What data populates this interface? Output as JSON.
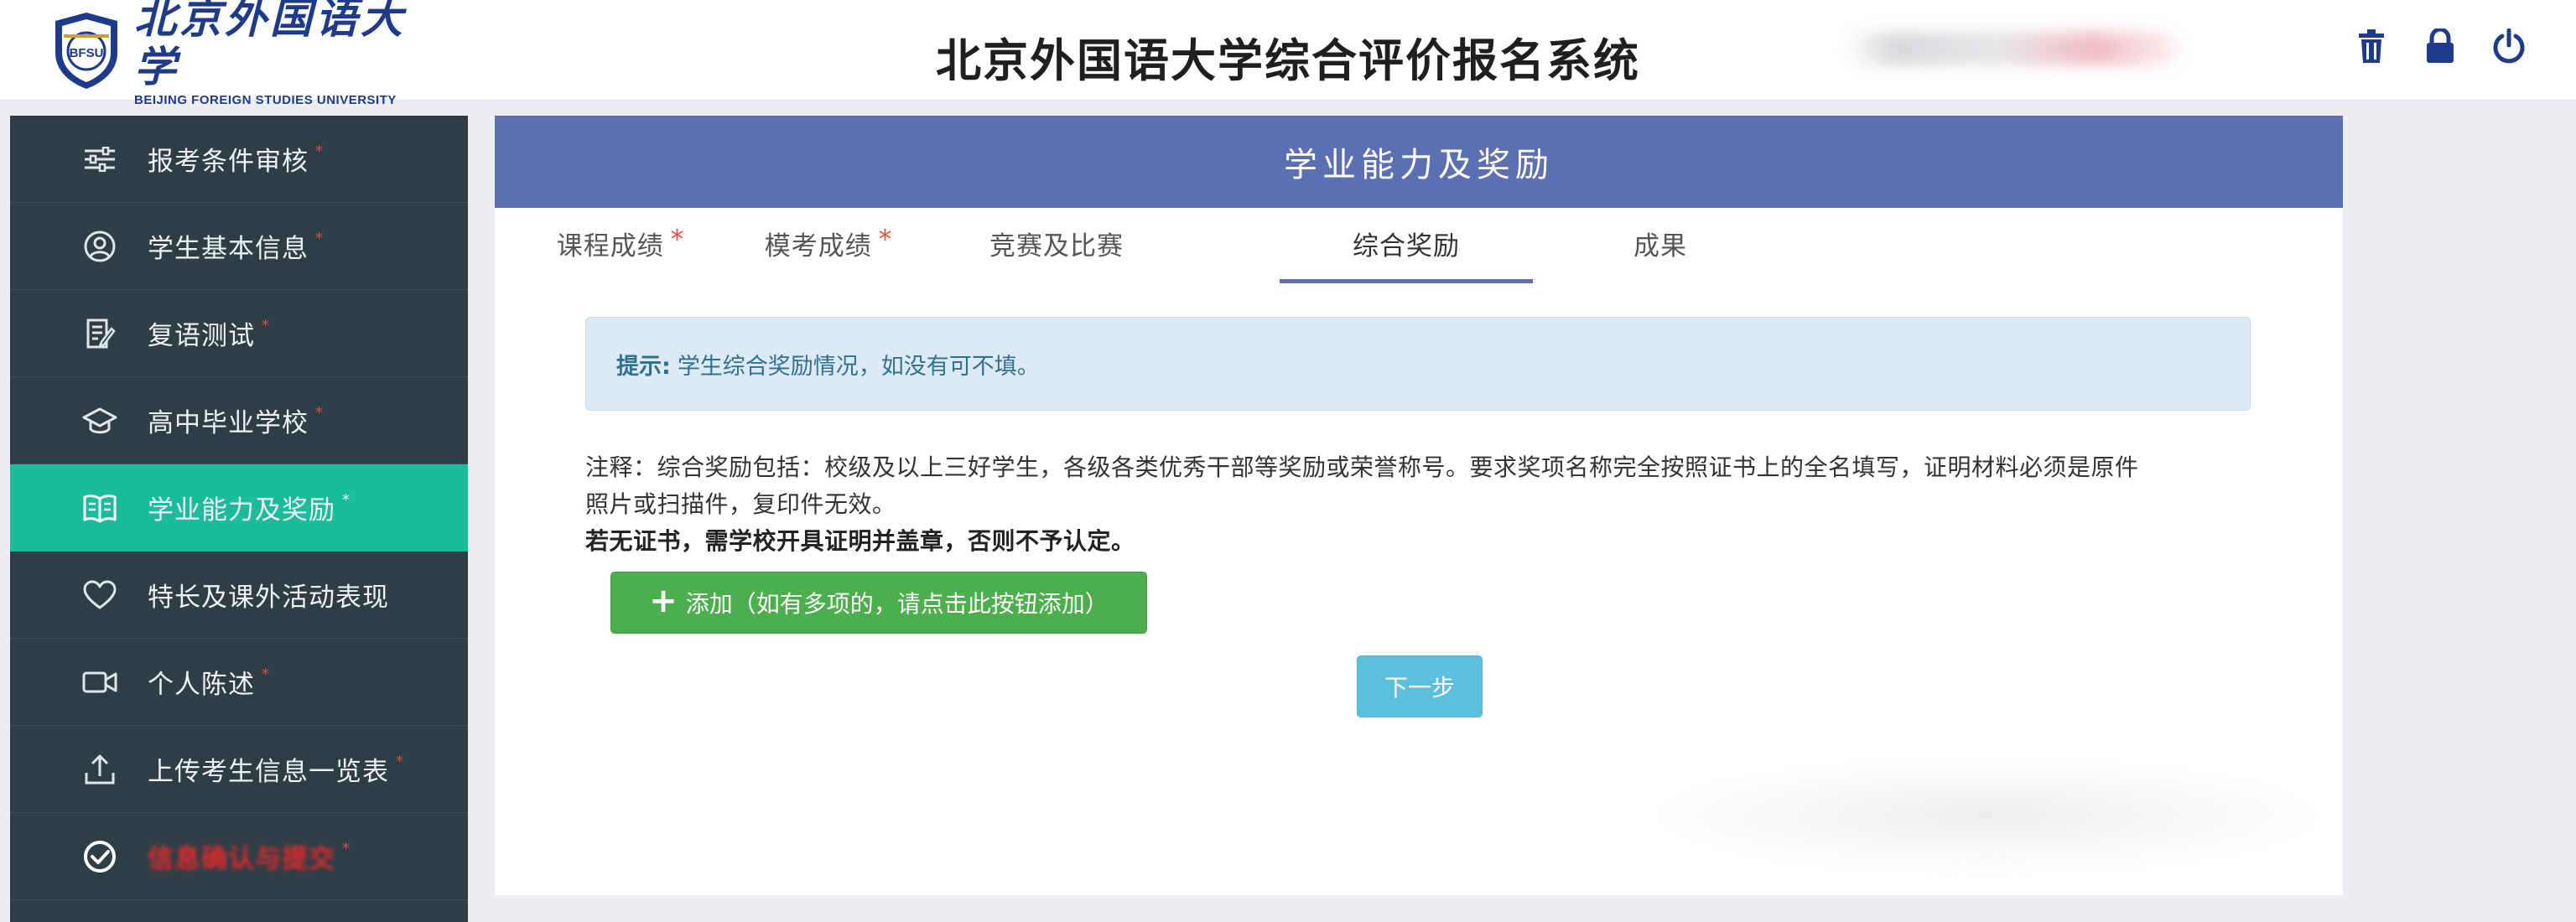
{
  "header": {
    "logo_cn": "北京外国语大学",
    "logo_en": "BEIJING FOREIGN STUDIES UNIVERSITY",
    "logo_seal_text": "BFSU",
    "title": "北京外国语大学综合评价报名系统",
    "icons": [
      "trash-icon",
      "lock-icon",
      "power-icon"
    ]
  },
  "sidebar": {
    "items": [
      {
        "label": "报考条件审核",
        "icon": "sliders-icon",
        "required": "*"
      },
      {
        "label": "学生基本信息",
        "icon": "user-circle-icon",
        "required": "*"
      },
      {
        "label": "复语测试",
        "icon": "edit-document-icon",
        "required": "*"
      },
      {
        "label": "高中毕业学校",
        "icon": "graduation-cap-icon",
        "required": "*"
      },
      {
        "label": "学业能力及奖励",
        "icon": "book-icon",
        "required": "*",
        "active": true
      },
      {
        "label": "特长及课外活动表现",
        "icon": "heart-icon",
        "required": ""
      },
      {
        "label": "个人陈述",
        "icon": "video-icon",
        "required": "*"
      },
      {
        "label": "上传考生信息一览表",
        "icon": "upload-icon",
        "required": "*"
      },
      {
        "label": "信息确认与提交",
        "icon": "check-circle-icon",
        "required": "*",
        "redacted": true
      }
    ]
  },
  "main": {
    "section_title": "学业能力及奖励",
    "tabs": [
      {
        "label": "课程成绩",
        "required": "*"
      },
      {
        "label": "模考成绩",
        "required": "*"
      },
      {
        "label": "竞赛及比赛",
        "required": ""
      },
      {
        "label": "综合奖励",
        "required": "",
        "active": true
      },
      {
        "label": "成果",
        "required": ""
      }
    ],
    "tip": {
      "prefix": "提示:",
      "text": "学生综合奖励情况，如没有可不填。"
    },
    "note_line1": "注释：综合奖励包括：校级及以上三好学生，各级各类优秀干部等奖励或荣誉称号。要求奖项名称完全按照证书上的全名填写，证明材料必须是原件",
    "note_line2": "照片或扫描件，复印件无效。",
    "note_bold": "若无证书，需学校开具证明并盖章，否则不予认定。",
    "add_button": "添加（如有多项的，请点击此按钮添加）",
    "next_button": "下一步"
  },
  "colors": {
    "sidebar_bg": "#2f3d46",
    "sidebar_active": "#1abc9c",
    "banner": "#5b6fb2",
    "add_button": "#4cae4c",
    "next_button": "#5bc0de",
    "tip_bg": "#dceaf6",
    "required_star": "#e74c3c"
  }
}
